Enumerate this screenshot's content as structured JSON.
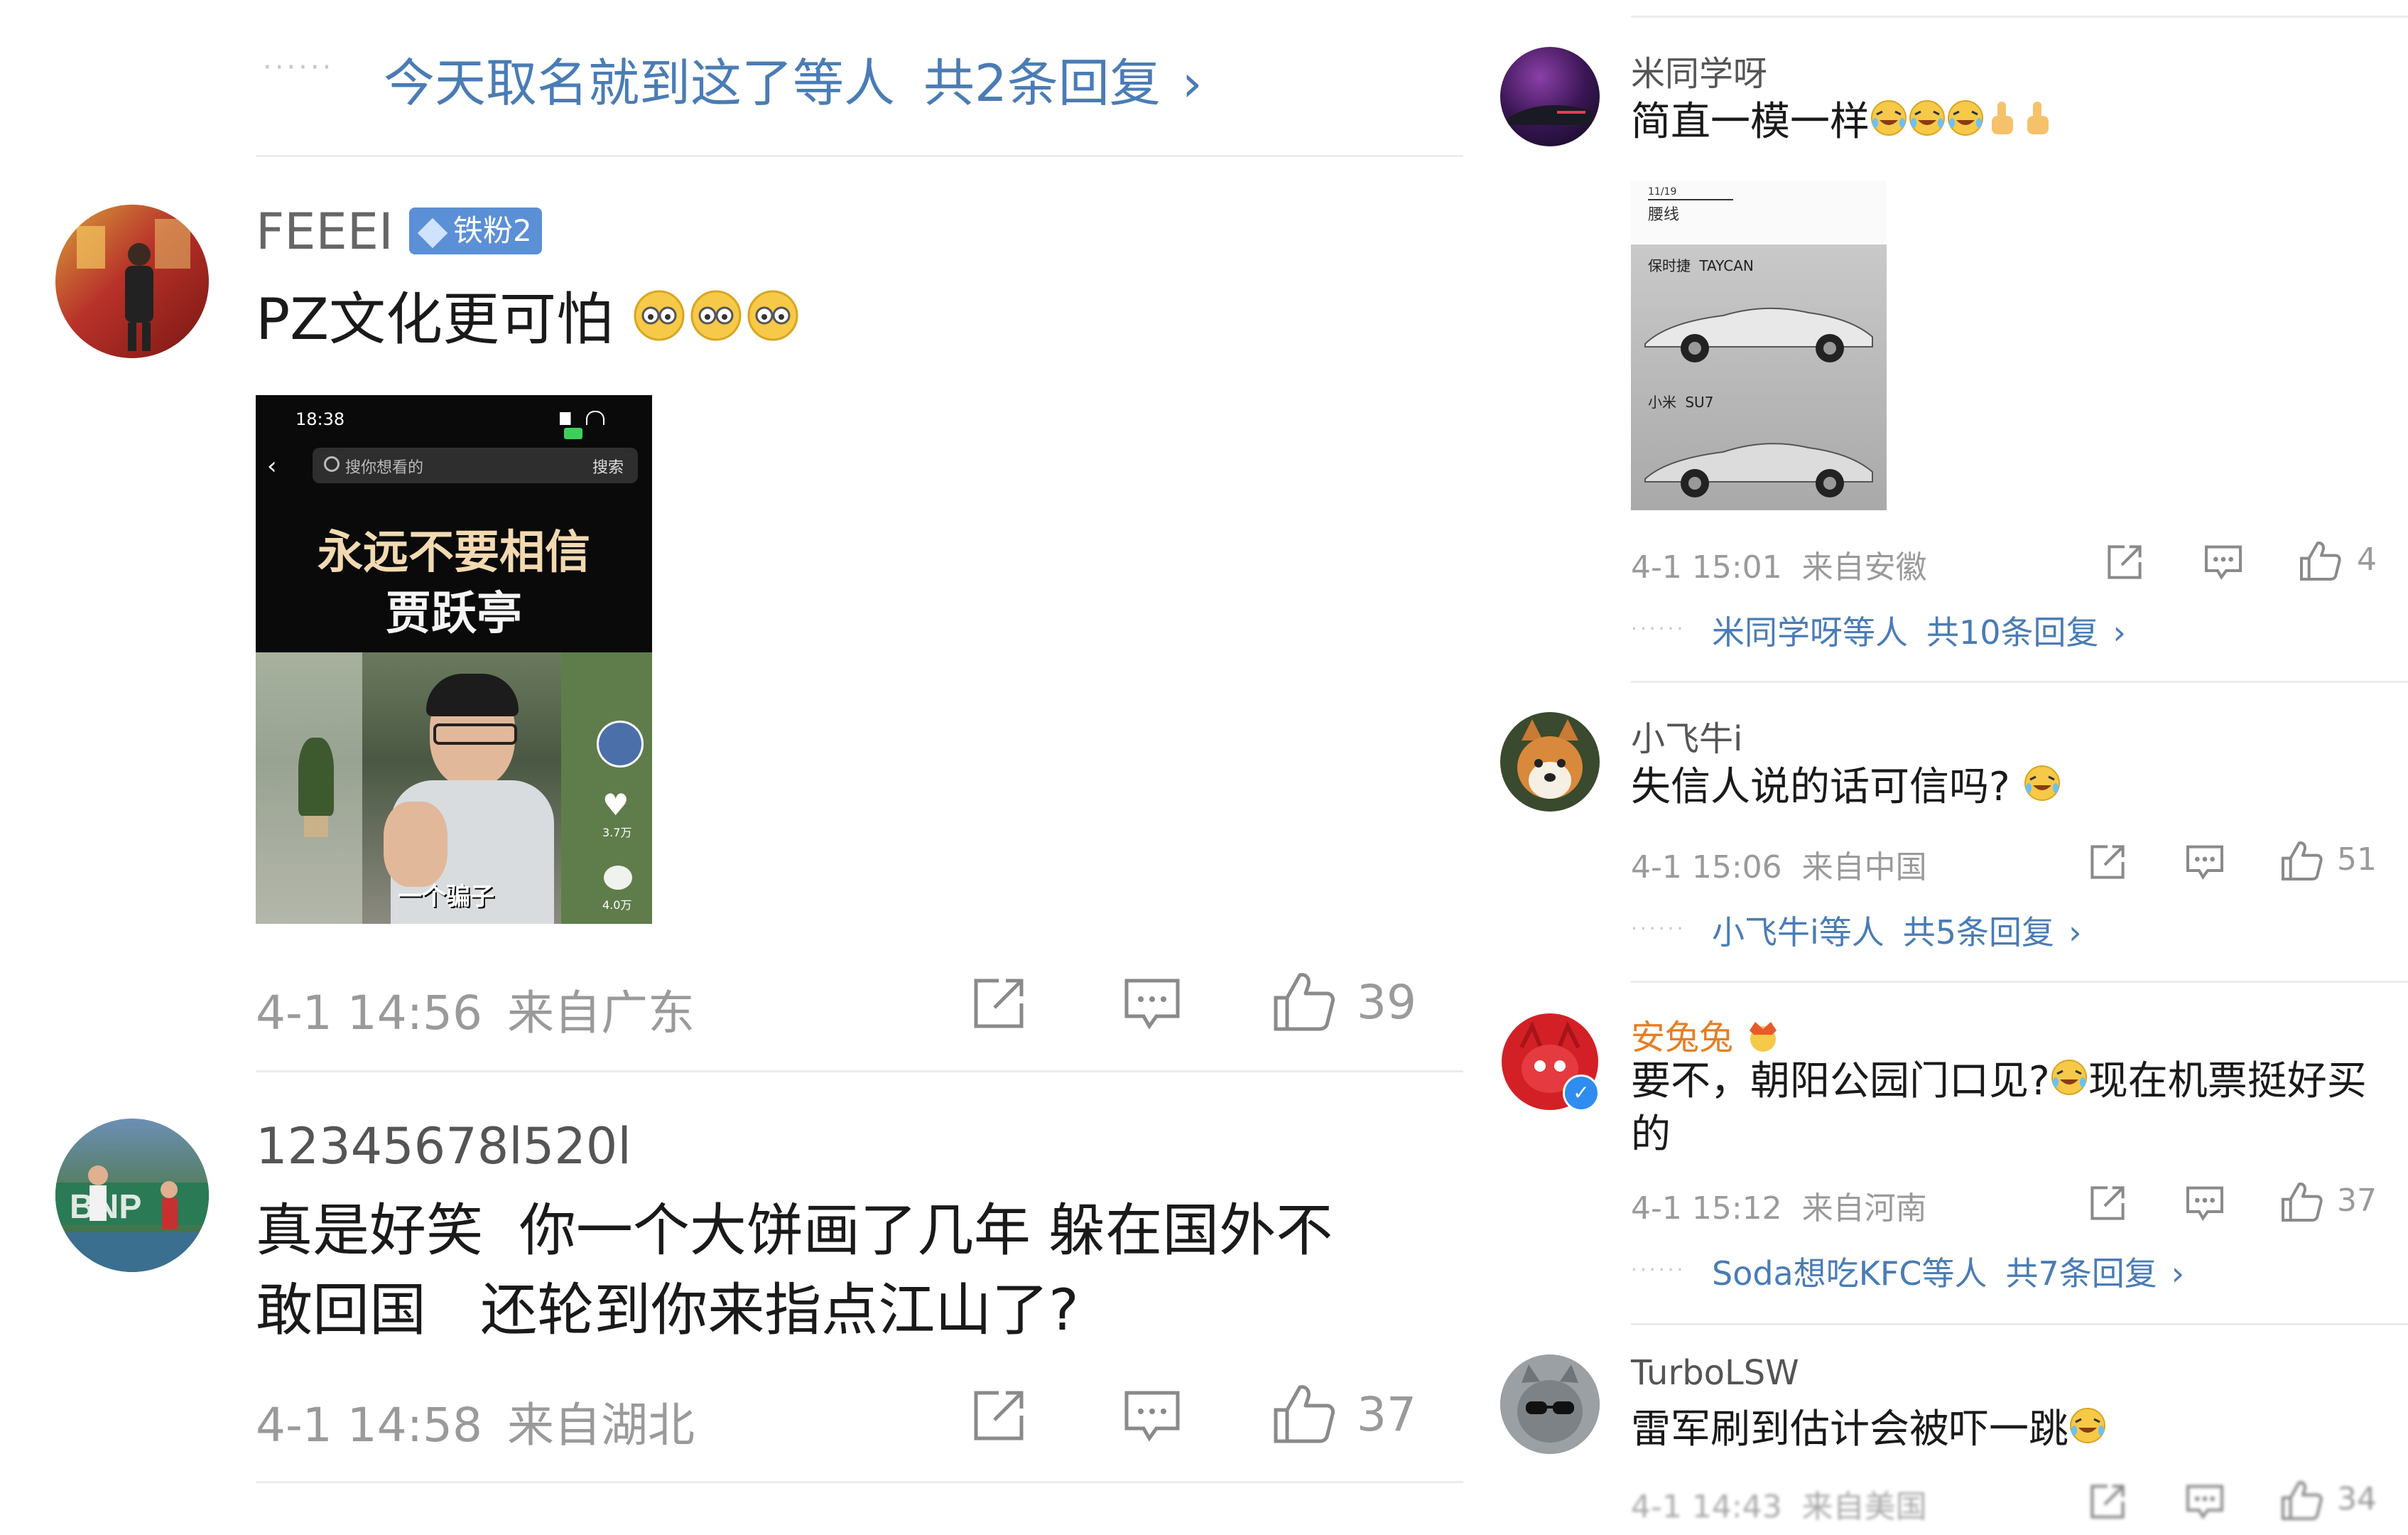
{
  "left_col": {
    "top_reply": {
      "users": "今天取名就到这了等人",
      "count": "共2条回复",
      "chevron": "›"
    },
    "comments": [
      {
        "username": "FEEEI",
        "badge": "铁粉2",
        "text": "PZ文化更可怕",
        "image": {
          "time": "18:38",
          "search_placeholder": "搜你想看的",
          "search_btn": "搜索",
          "line1": "永远不要相信",
          "line2": "贾跃亭",
          "subtitle": "一个骗子",
          "like_count": "3.7万",
          "comment_count": "4.0万"
        },
        "date": "4-1 14:56",
        "location": "来自广东",
        "likes": "39"
      },
      {
        "username": "12345678l520l",
        "text_line1": "真是好笑  你一个大饼画了几年 躲在国外不",
        "text_line2": "敢回国   还轮到你来指点江山了?",
        "date": "4-1 14:58",
        "location": "来自湖北",
        "likes": "37"
      }
    ]
  },
  "right_col": {
    "comments": [
      {
        "username": "米同学呀",
        "text": "简直一模一样",
        "image": {
          "date": "11/19",
          "tag": "腰线",
          "brand1": "保时捷",
          "model1": "TAYCAN",
          "brand2": "小米",
          "model2": "SU7"
        },
        "date": "4-1 15:01",
        "location": "来自安徽",
        "likes": "4",
        "reply_users": "米同学呀等人",
        "reply_count": "共10条回复"
      },
      {
        "username": "小飞牛i",
        "text": "失信人说的话可信吗?",
        "date": "4-1 15:06",
        "location": "来自中国",
        "likes": "51",
        "reply_users": "小飞牛i等人",
        "reply_count": "共5条回复"
      },
      {
        "username": "安兔兔",
        "text_line1": "要不，朝阳公园门口见?",
        "text_line1b": "现在机票挺好买",
        "text_line2": "的",
        "date": "4-1 15:12",
        "location": "来自河南",
        "likes": "37",
        "reply_users": "Soda想吃KFC等人",
        "reply_count": "共7条回复"
      },
      {
        "username": "TurboLSW",
        "text": "雷军刷到估计会被吓一跳",
        "date": "4-1 14:43",
        "location": "来自美国",
        "likes": "34"
      }
    ]
  },
  "chevron": "›",
  "colors": {
    "link": "#4a7cb5",
    "meta": "#9a9a9a",
    "vip": "#e67e22",
    "badge": "#5b8fd6"
  }
}
